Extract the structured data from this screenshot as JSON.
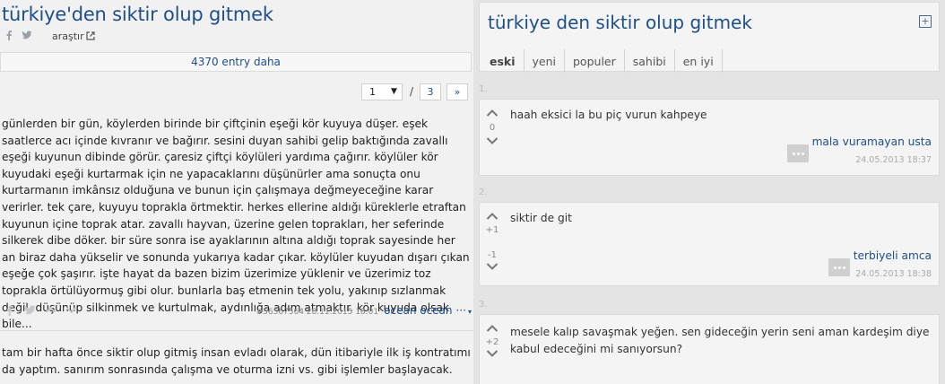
{
  "left": {
    "title": "türkiye'den siktir olup gitmek",
    "search_label": "araştır",
    "more_entries": "4370 entry daha",
    "pager": {
      "current": "1",
      "separator": "/",
      "total": "3",
      "next": "»"
    },
    "entries": [
      {
        "text": "günlerden bir gün, köylerden birinde bir çiftçinin eşeği kör kuyuya düşer. eşek saatlerce acı içinde kıvranır ve bağırır. sesini duyan sahibi gelip baktığında zavallı eşeği kuyunun dibinde görür. çaresiz çiftçi köylüleri yardıma çağırır. köylüler kör kuyudaki eşeği kurtarmak için ne yapacaklarını düşünürler ama sonuçta onu kurtarmanın imkânsız olduğuna ve bunun için çalışmaya değmeyeceğine karar verirler. tek çare, kuyuyu toprakla örtmektir. herkes ellerine aldığı küreklerle etraftan kuyunun içine toprak atar. zavallı hayvan, üzerine gelen toprakları, her seferinde silkerek dibe döker. bir süre sonra ise ayaklarının altına aldığı toprak sayesinde her an biraz daha yükselir ve sonunda yukarıya kadar çıkar. köylüler kuyudan dışarı çıkan eşeğe çok şaşırır. işte hayat da bazen bizim üzerimize yüklenir ve üzerimiz toz toprakla örtülüyormuş gibi olur. bunlarla baş etmenin tek yolu, yakınıp sızlanmak değil, düşünüp silkinmek ve kurtulmak, aydınlığa adım atmaktır. kör kuyuda olsak bile...",
        "id_date": "#56567564 28.11.2015 18:01",
        "author": "ocean ocean",
        "menu": "···"
      },
      {
        "text": "tam bir hafta önce siktir olup gitmiş insan evladı olarak, dün itibariyle ilk iş kontratımı da yaptım. sanırım sonrasında çalışma ve oturma izni vs. gibi işlemler başlayacak."
      }
    ]
  },
  "right": {
    "title": "türkiye den siktir olup gitmek",
    "expand": "+",
    "tabs": [
      "eski",
      "yeni",
      "populer",
      "sahibi",
      "en iyi"
    ],
    "active_tab": "eski",
    "entries": [
      {
        "num": "1.",
        "text": "haah eksici la bu piç vurun kahpeye",
        "votes": "0",
        "author": "mala vuramayan usta",
        "date": "24.05.2013 18:37"
      },
      {
        "num": "2.",
        "text": "siktir de git",
        "votes_up": "+1",
        "votes_down": "-1",
        "author": "terbiyeli amca",
        "date": "24.05.2013 18:38"
      },
      {
        "num": "3.",
        "text": "mesele kalıp savaşmak yeğen. sen gideceğin yerin seni aman kardeşim diye kabul edeceğini mi sanıyorsun?",
        "votes": "+2"
      }
    ]
  }
}
